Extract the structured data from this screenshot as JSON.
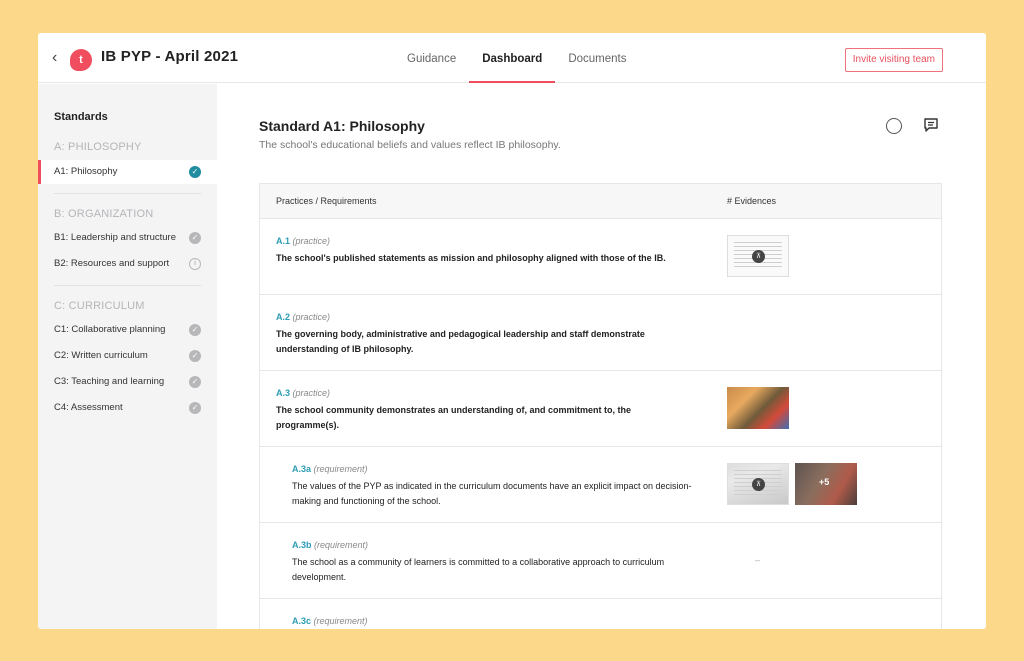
{
  "app": {
    "title": "IB PYP - April 2021",
    "logo_letter": "t",
    "back_glyph": "‹"
  },
  "tabs": [
    {
      "label": "Guidance",
      "active": false
    },
    {
      "label": "Dashboard",
      "active": true
    },
    {
      "label": "Documents",
      "active": false
    }
  ],
  "invite_label": "Invite visiting team",
  "sidebar": {
    "heading": "Standards",
    "groups": [
      {
        "label": "A: PHILOSOPHY",
        "items": [
          {
            "label": "A1: Philosophy",
            "status": "active-check"
          }
        ]
      },
      {
        "label": "B: ORGANIZATION",
        "items": [
          {
            "label": "B1: Leadership and structure",
            "status": "check"
          },
          {
            "label": "B2: Resources and support",
            "status": "info"
          }
        ]
      },
      {
        "label": "C: CURRICULUM",
        "items": [
          {
            "label": "C1: Collaborative planning",
            "status": "check"
          },
          {
            "label": "C2: Written curriculum",
            "status": "check"
          },
          {
            "label": "C3: Teaching and learning",
            "status": "check"
          },
          {
            "label": "C4: Assessment",
            "status": "check"
          }
        ]
      }
    ]
  },
  "standard": {
    "title": "Standard A1: Philosophy",
    "subtitle": "The school's educational beliefs and values reflect IB philosophy."
  },
  "table": {
    "headers": [
      "Practices / Requirements",
      "# Evidences"
    ],
    "rows": [
      {
        "code": "A.1",
        "kind": "(practice)",
        "text": "The school's published statements as mission and philosophy aligned with those of the IB.",
        "evidence": [
          "pdf-document"
        ]
      },
      {
        "code": "A.2",
        "kind": "(practice)",
        "text": "The governing body, administrative and pedagogical leadership and staff demonstrate understanding of IB philosophy.",
        "evidence": []
      },
      {
        "code": "A.3",
        "kind": "(practice)",
        "text": "The school community demonstrates an understanding of, and commitment to, the programme(s).",
        "evidence": [
          "classroom-photo"
        ]
      },
      {
        "code": "A.3a",
        "kind": "(requirement)",
        "text": "The values of the PYP as indicated in the curriculum documents have an explicit impact on decision-making and functioning of the school.",
        "evidence": [
          "pdf-document",
          "photo-more"
        ],
        "more": "+5"
      },
      {
        "code": "A.3b",
        "kind": "(requirement)",
        "text": "The school as a community of learners is committed to a collaborative approach to curriculum development.",
        "evidence": [],
        "empty": "–"
      },
      {
        "code": "A.3c",
        "kind": "(requirement)",
        "text": "",
        "evidence": []
      }
    ]
  },
  "colors": {
    "accent": "#f04e5e",
    "link": "#2a9db5",
    "frame_bg": "#fbd88a"
  }
}
